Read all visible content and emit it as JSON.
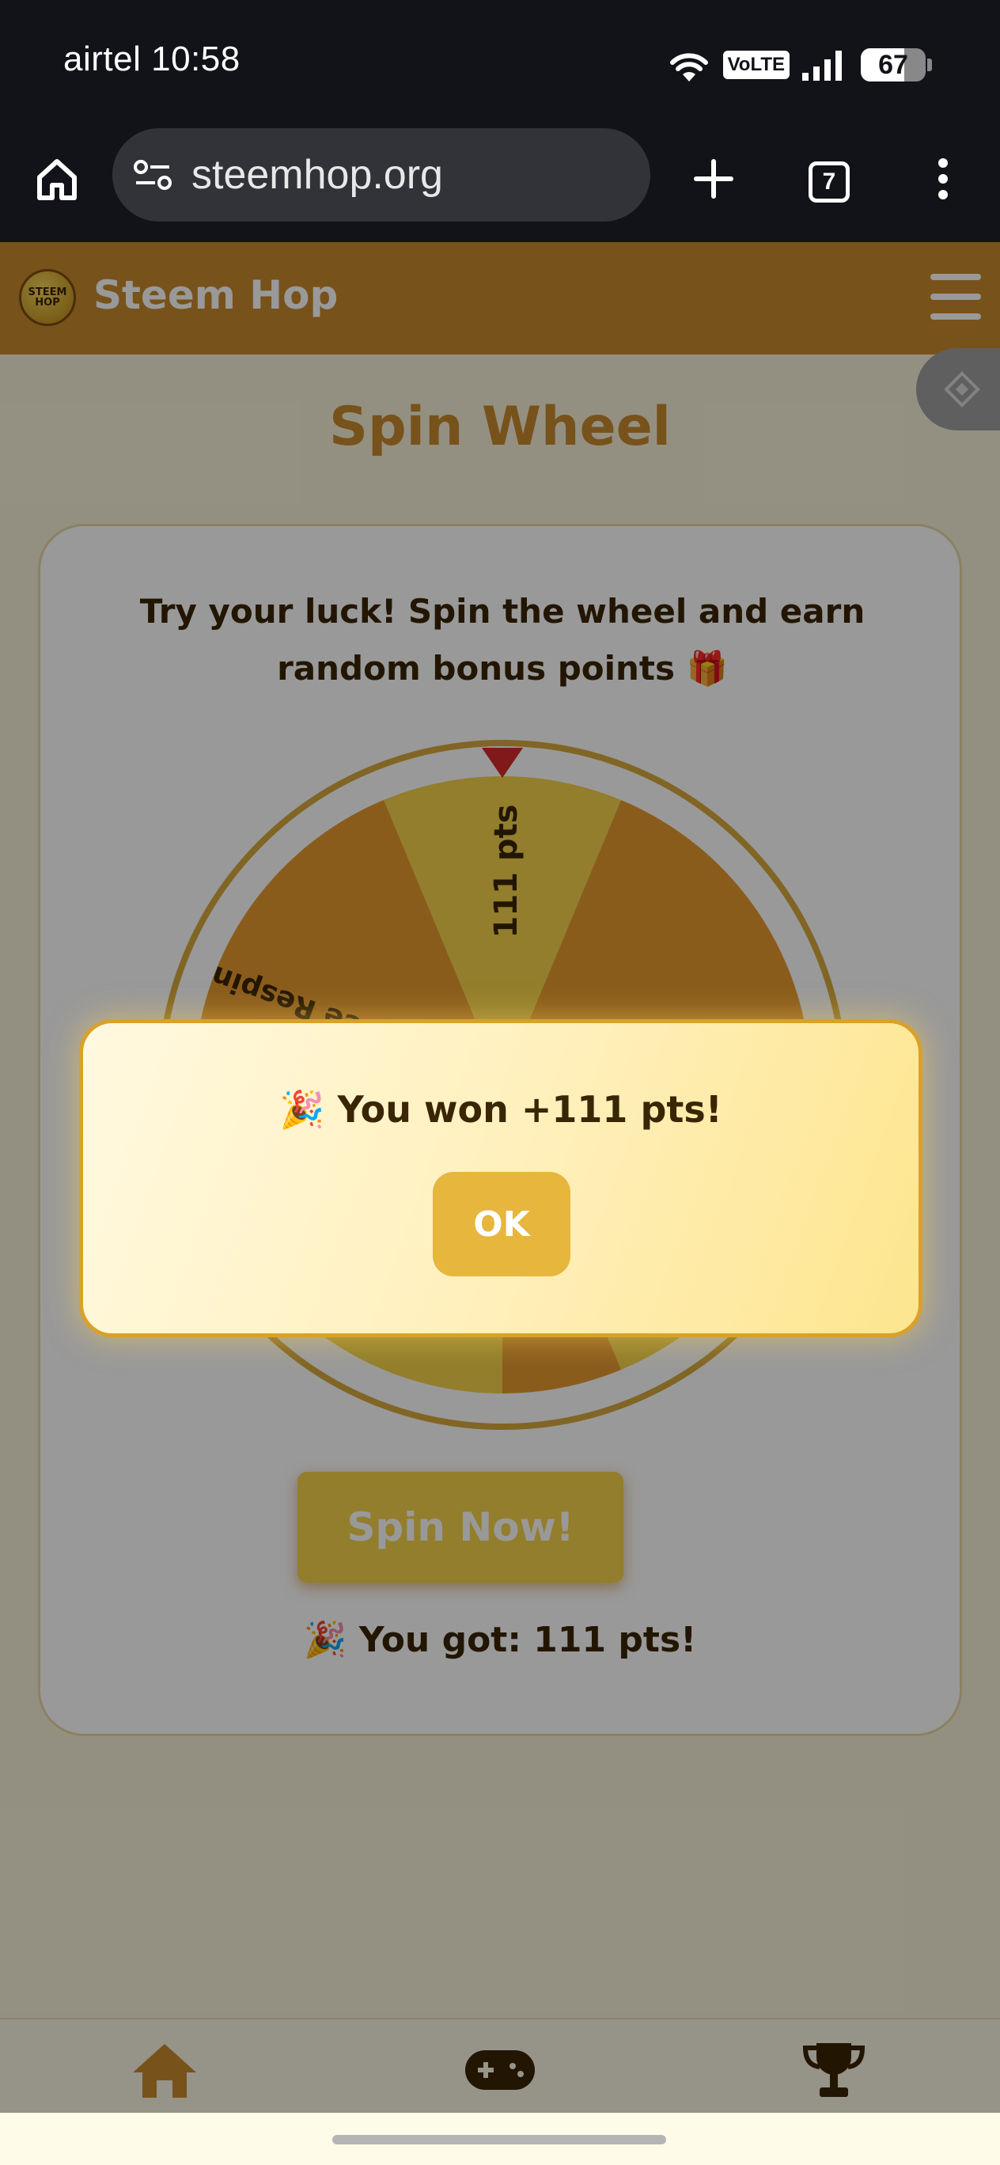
{
  "status_bar": {
    "carrier": "airtel",
    "time": "10:58",
    "volte": "VoLTE",
    "battery": "67",
    "battery_level": 0.67
  },
  "browser": {
    "url": "steemhop.org",
    "tab_count": "7"
  },
  "app": {
    "brand": "Steem Hop",
    "logo_text": "STEEM HOP"
  },
  "page": {
    "title": "Spin Wheel",
    "description": "Try your luck! Spin the wheel and earn random bonus points 🎁",
    "wheel_segments": [
      "111 pts",
      "Free Respin"
    ],
    "spin_button": "Spin Now!",
    "result": "🎉 You got: 111 pts!"
  },
  "modal": {
    "message": "🎉 You won +111 pts!",
    "ok_label": "OK"
  },
  "colors": {
    "brand": "#c9892d",
    "wheel_yellow": "#f3d34a",
    "wheel_orange": "#e79a2f",
    "pointer": "#d52b2b"
  },
  "icons": [
    "home-icon",
    "tune-icon",
    "plus-icon",
    "tabs-icon",
    "more-icon",
    "menu-icon",
    "binance-icon",
    "gamepad-icon",
    "trophy-icon"
  ]
}
